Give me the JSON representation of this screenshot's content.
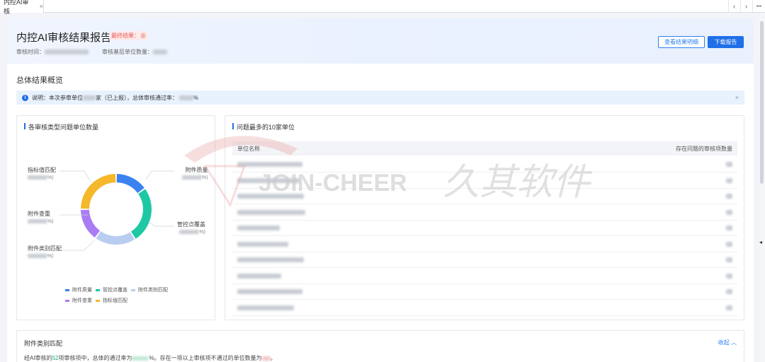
{
  "tabs": [
    {
      "label": "内控AI审核",
      "close": "×"
    }
  ],
  "tab_controls": [
    "‹",
    "›",
    "•••"
  ],
  "header": {
    "title": "内控AI审核结果报告",
    "final_result_label": "最终结果：",
    "audit_time_label": "审核时间：",
    "unit_count_label": "审核基层单位数量：",
    "btn_view_details": "查看结果明细",
    "btn_download": "下载报告"
  },
  "overview": {
    "title": "总体结果概览",
    "notice_prefix": "说明：本次参审单位",
    "notice_middle": "家（已上报），总体审核通过率：",
    "notice_suffix": "%",
    "notice_close": "×"
  },
  "donut_card": {
    "title": "各审核类型问题单位数量",
    "labels": {
      "attachment_quality": "附件质量",
      "control_coverage": "管控点覆盖",
      "attachment_category": "附件类别匹配",
      "attachment_duplicate": "附件查重",
      "indicator_match": "指标值匹配"
    },
    "label_suffix": "%)",
    "legend": [
      "附件质量",
      "管控点覆盖",
      "附件类别匹配",
      "附件查重",
      "指标值匹配"
    ]
  },
  "top10_card": {
    "title": "问题最多的10家单位",
    "col_unit": "单位名称",
    "col_count": "存在问题的审核项数量",
    "rows": 10
  },
  "attachment_section": {
    "title": "附件类别匹配",
    "collapse": "收起 ︿",
    "summary_prefix": "经AI审核的",
    "summary_num": "52",
    "summary_mid1": "项审核项中，总体的通过率为",
    "summary_mid2": "%。存在一项以上审核项不通过的单位数量为",
    "summary_end": "。"
  },
  "watermark": {
    "en": "JOIN-CHEER",
    "cn": "久其软件"
  },
  "colors": {
    "primary": "#1f6fe8",
    "attachment_quality": "#3b82f0",
    "control_coverage": "#1ec8a5",
    "attachment_category": "#b8cdf0",
    "attachment_duplicate": "#a97cf3",
    "indicator_match": "#f5b82a"
  },
  "chart_data": {
    "type": "pie",
    "title": "各审核类型问题单位数量",
    "categories": [
      "附件质量",
      "管控点覆盖",
      "附件类别匹配",
      "附件查重",
      "指标值匹配"
    ],
    "values": [
      15,
      26,
      19,
      15,
      25
    ]
  }
}
